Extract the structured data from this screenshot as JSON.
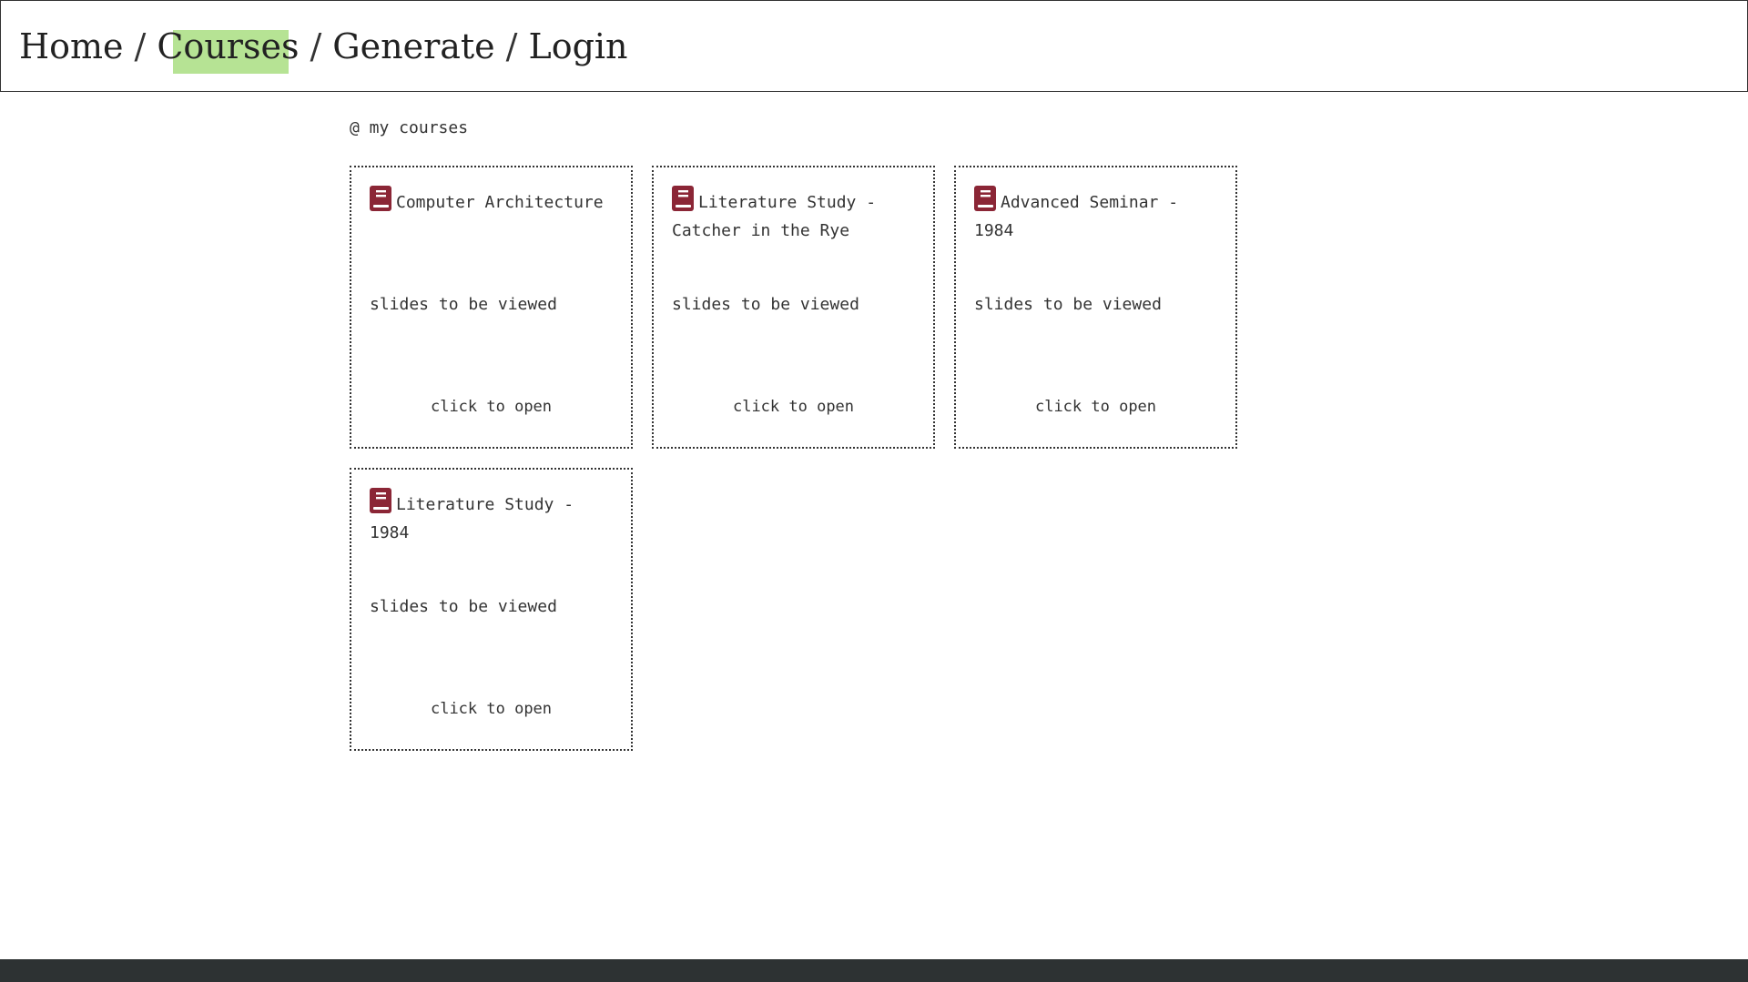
{
  "colors": {
    "highlight": "#b6e394",
    "book_icon": "#8b2636",
    "footer": "#2d3233"
  },
  "nav": {
    "items": [
      {
        "label": "Home",
        "active": false
      },
      {
        "label": "Courses",
        "active": true
      },
      {
        "label": "Generate",
        "active": false
      },
      {
        "label": "Login",
        "active": false
      }
    ],
    "separator": "/"
  },
  "main": {
    "section_title": "@ my courses",
    "courses": [
      {
        "icon": "book-icon",
        "title": "Computer Architecture",
        "subtitle": "slides to be viewed",
        "action": "click to open"
      },
      {
        "icon": "book-icon",
        "title": "Literature Study - Catcher in the Rye",
        "subtitle": "slides to be viewed",
        "action": "click to open"
      },
      {
        "icon": "book-icon",
        "title": "Advanced Seminar - 1984",
        "subtitle": "slides to be viewed",
        "action": "click to open"
      },
      {
        "icon": "book-icon",
        "title": "Literature Study - 1984",
        "subtitle": "slides to be viewed",
        "action": "click to open"
      }
    ]
  }
}
